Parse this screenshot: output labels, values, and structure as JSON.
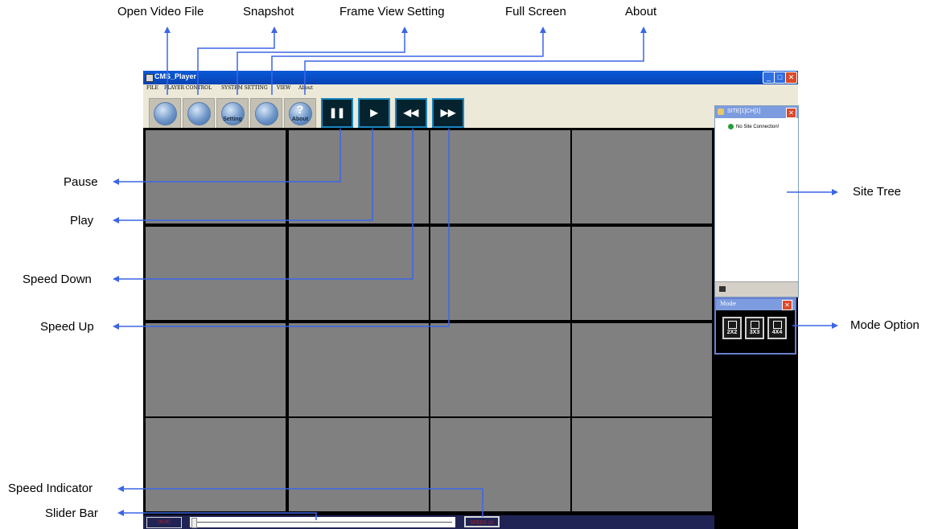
{
  "window": {
    "title": "CMS_Player",
    "controls": {
      "minimize": "_",
      "maximize": "□",
      "close": "✕"
    },
    "title_color": "#0743b4"
  },
  "menu": {
    "items": [
      "FILE",
      "PLAYER CONTROL",
      "SYSTEM SETTING",
      "VIEW",
      "About"
    ]
  },
  "toolbar": {
    "setting_caption": "Setting",
    "about_caption": "About",
    "about_glyph": "?",
    "pause_glyph": "❚❚",
    "play_glyph": "▶",
    "speed_down_glyph": "◀◀",
    "speed_up_glyph": "▶▶"
  },
  "annotations": {
    "open_video_file": "Open Video File",
    "snapshot": "Snapshot",
    "frame_view_setting": "Frame View Setting",
    "full_screen": "Full Screen",
    "about": "About",
    "pause": "Pause",
    "play": "Play",
    "speed_down": "Speed Down",
    "speed_up": "Speed Up",
    "site_tree": "Site Tree",
    "mode_option": "Mode Option",
    "speed_indicator": "Speed Indicator",
    "slider_bar": "Slider Bar"
  },
  "site_tree": {
    "title": "SITE[1]CH[1]",
    "close": "✕",
    "node_label": "No Site Connection!"
  },
  "mode_panel": {
    "title": "Mode",
    "close": "✕",
    "options": [
      "2X2",
      "3X3",
      "4X4"
    ]
  },
  "playback": {
    "left_label": "00:00",
    "speed_label": "SPEED 1X",
    "slider_position": 0.0
  },
  "colors": {
    "annotation_arrow": "#3c66e6",
    "grid_cell": "#808080",
    "panel_accent": "#7d9ce0"
  }
}
